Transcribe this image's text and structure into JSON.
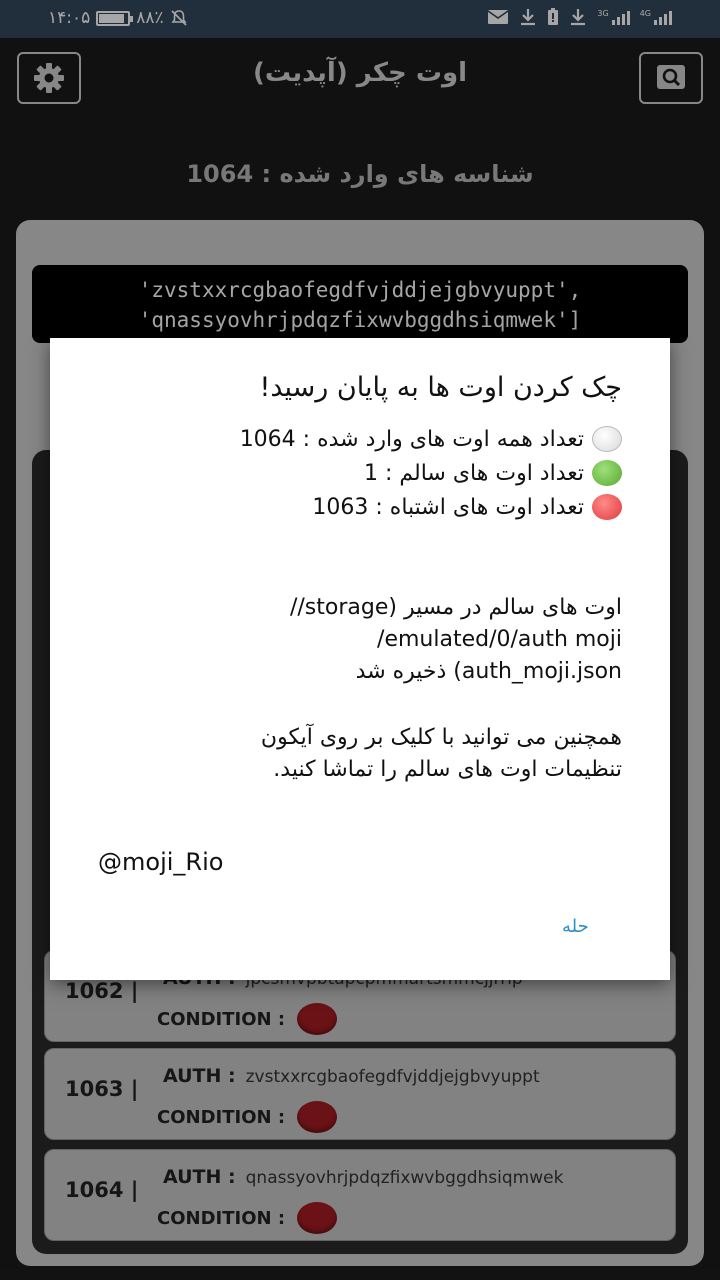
{
  "status_bar": {
    "time": "۱۴:۰۵",
    "battery": "۸۸٪",
    "battery_level": 0.88,
    "icons": [
      "battery-icon",
      "mute-icon",
      "mail-icon",
      "download-icon",
      "alert-battery-icon",
      "download-icon",
      "signal-3g-icon",
      "signal-4g-icon"
    ],
    "net1": "3G",
    "net2": "4G"
  },
  "app_bar": {
    "title": "اوت چکر (آپدیت)",
    "settings_icon": "gear-icon",
    "search_icon": "search-icon"
  },
  "entered_count": "شناسه های وارد شده : 1064",
  "auth_box": {
    "line1": "'zvstxxrcgbaofegdfvjddjejgbvyuppt',",
    "line2": "'qnassyovhrjpdqzfixwvbggdhsiqmwek']"
  },
  "list": [
    {
      "number": "1062 |",
      "auth_label": "AUTH :",
      "auth_value": "jpcsmvpbtapcpmmartsmmcjjrrip",
      "condition_label": "CONDITION :",
      "condition_color": "#a51c22"
    },
    {
      "number": "1063 |",
      "auth_label": "AUTH :",
      "auth_value": "zvstxxrcgbaofegdfvjddjejgbvyuppt",
      "condition_label": "CONDITION :",
      "condition_color": "#a51c22"
    },
    {
      "number": "1064 |",
      "auth_label": "AUTH :",
      "auth_value": "qnassyovhrjpdqzfixwvbggdhsiqmwek",
      "condition_label": "CONDITION :",
      "condition_color": "#a51c22"
    }
  ],
  "dialog": {
    "title": "چک کردن اوت ها به پایان رسید!",
    "total": "تعداد همه اوت های وارد شده : 1064",
    "healthy": "تعداد اوت های سالم : 1",
    "wrong": "تعداد اوت های اشتباه : 1063",
    "saved_line1": "اوت های سالم در مسیر (storage//",
    "saved_line2": "emulated/0/auth moji/",
    "saved_line3": "auth_moji.json) ذخیره شد",
    "hint_line1": "همچنین می توانید با کلیک بر روی آیکون",
    "hint_line2": "تنظیمات اوت های سالم را تماشا کنید.",
    "handle": "@moji_Rio",
    "ok_button": "حله"
  }
}
